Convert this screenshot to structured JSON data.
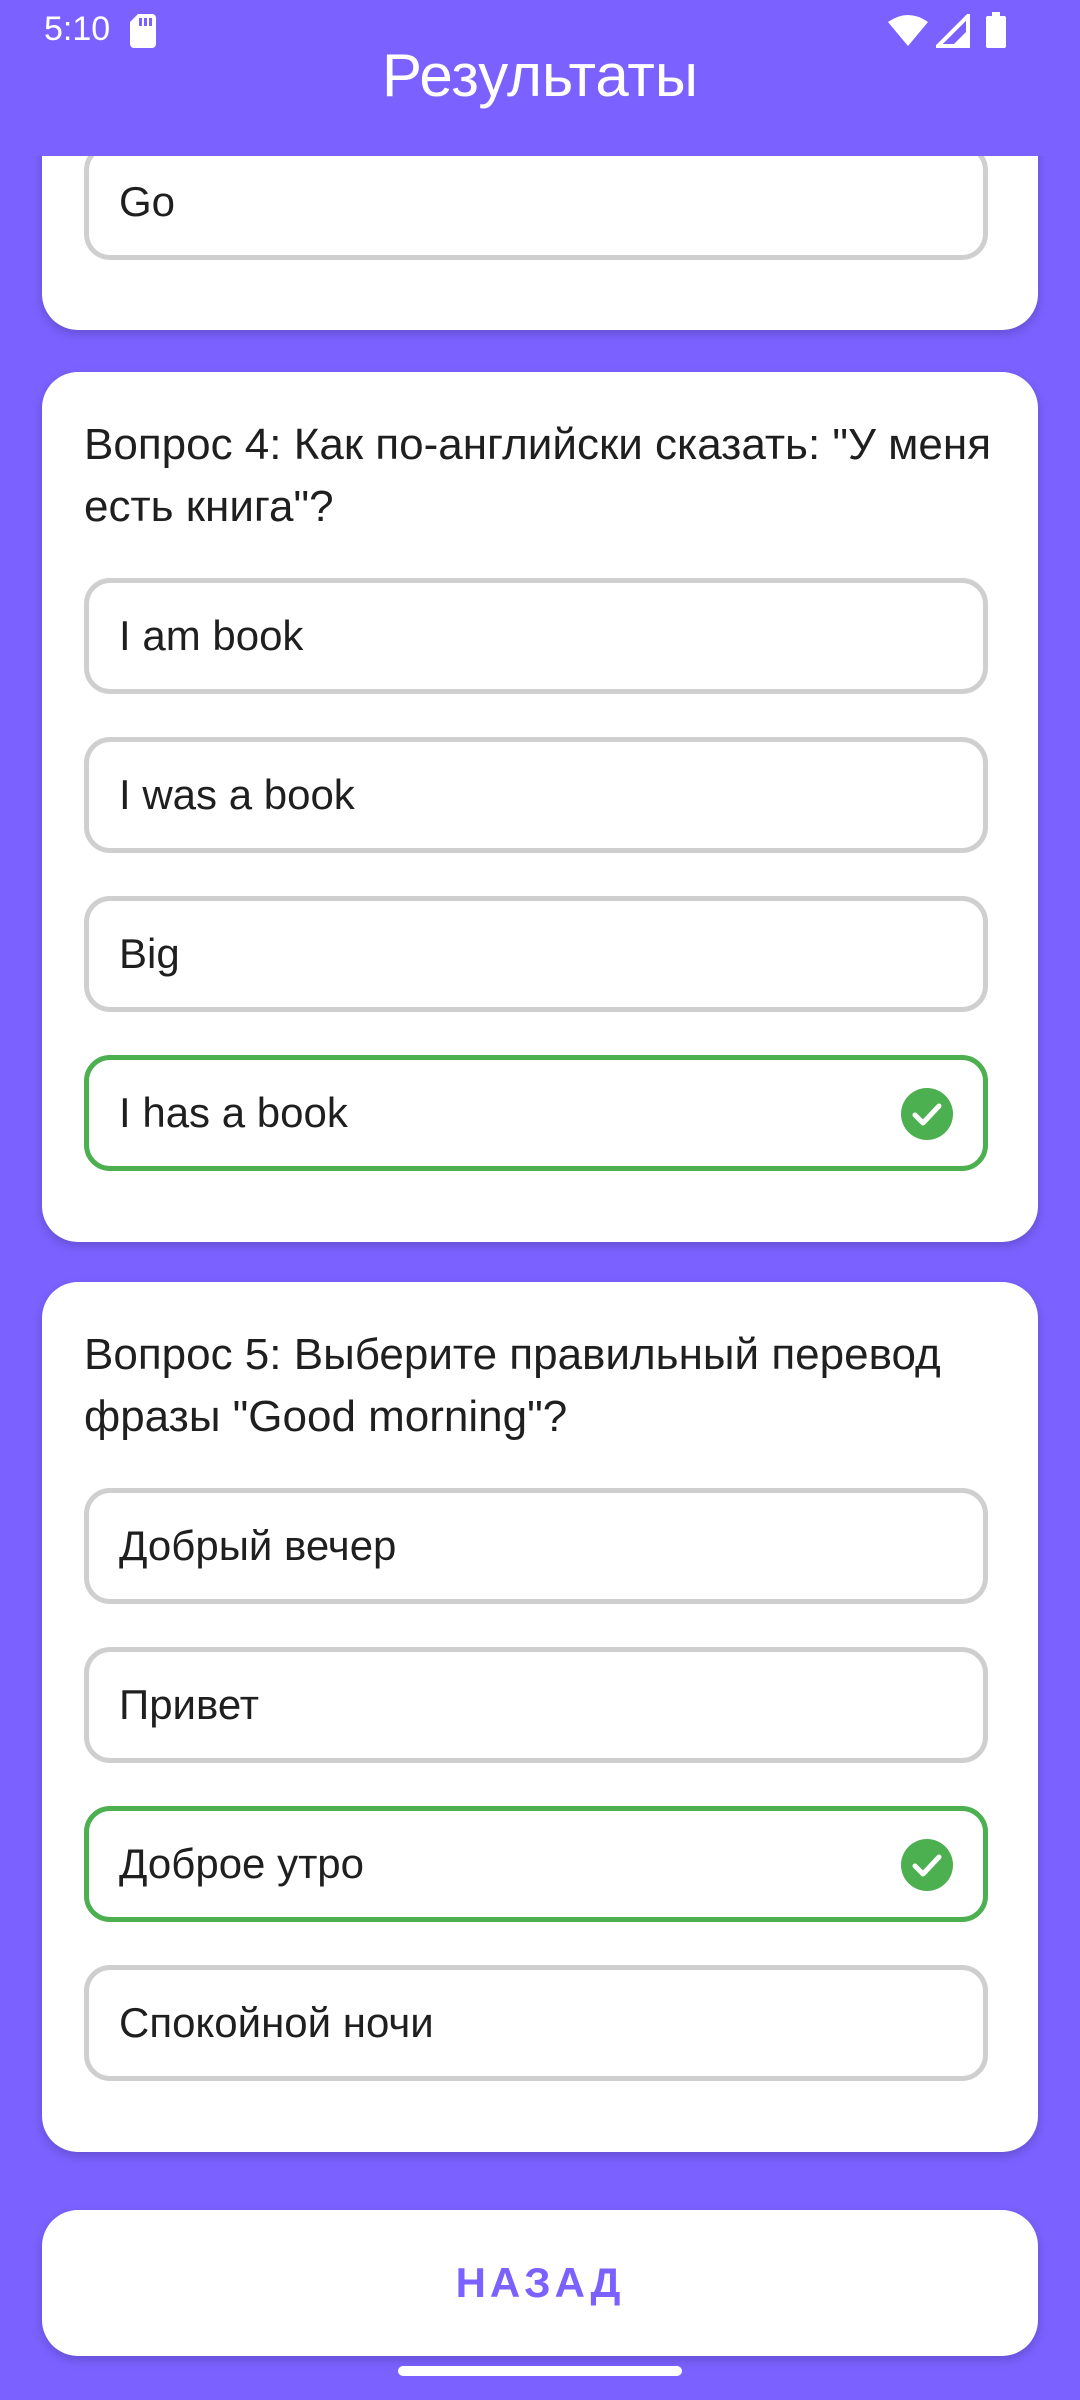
{
  "status_bar": {
    "time": "5:10"
  },
  "header": {
    "title": "Результаты"
  },
  "cards": [
    {
      "options": [
        {
          "label": "Go",
          "correct": false
        }
      ]
    },
    {
      "question": "Вопрос 4: Как по-английски сказать: \"У меня есть книга\"?",
      "options": [
        {
          "label": "I am book",
          "correct": false
        },
        {
          "label": "I was a book",
          "correct": false
        },
        {
          "label": "Big",
          "correct": false
        },
        {
          "label": "I has a book",
          "correct": true
        }
      ]
    },
    {
      "question": "Вопрос 5: Выберите правильный перевод фразы \"Good morning\"?",
      "options": [
        {
          "label": "Добрый вечер",
          "correct": false
        },
        {
          "label": "Привет",
          "correct": false
        },
        {
          "label": "Доброе утро",
          "correct": true
        },
        {
          "label": "Спокойной ночи",
          "correct": false
        }
      ]
    }
  ],
  "footer": {
    "back_label": "НАЗАД"
  },
  "colors": {
    "accent": "#7B61FF",
    "correct": "#4CAF50",
    "option_border": "#cfcfcf"
  }
}
